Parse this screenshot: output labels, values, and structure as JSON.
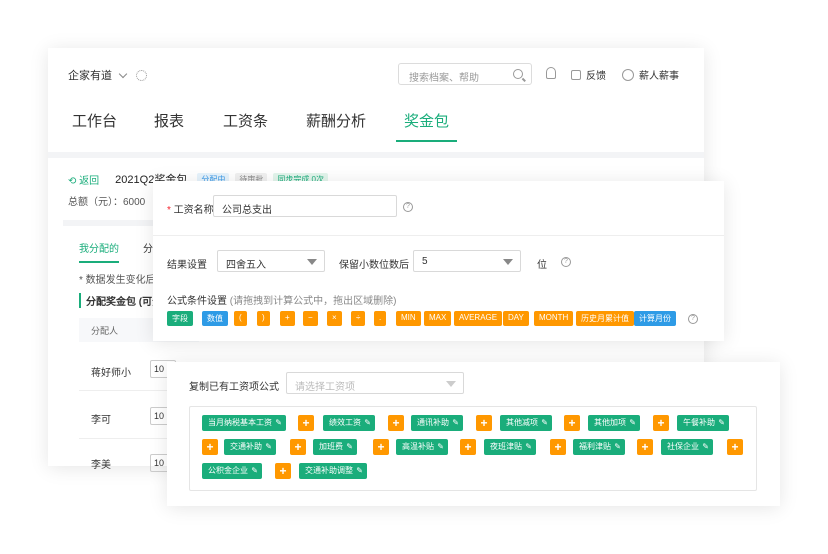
{
  "header": {
    "company": "企家有道",
    "search_placeholder": "搜索档案、帮助",
    "feedback": "反馈",
    "user": "薪人薪事"
  },
  "tabs": [
    "工作台",
    "报表",
    "工资条",
    "薪酬分析",
    "奖金包"
  ],
  "bonus": {
    "back": "返回",
    "title": "2021Q2奖金包",
    "badges": [
      "分配中",
      "待审批",
      "同步完成 0次"
    ],
    "total": "总额（元）：6000",
    "subtabs": [
      "我分配的",
      "分"
    ],
    "note": "* 数据发生变化后",
    "alloc_title": "分配奖金包 (可分",
    "col_allocator": "分配人",
    "rows": [
      {
        "name": "蒋好师小",
        "value": "10"
      },
      {
        "name": "李可",
        "value": "10"
      },
      {
        "name": "李美",
        "value": "10"
      }
    ]
  },
  "form": {
    "name_label": "工资名称",
    "name_value": "公司总支出",
    "result_label": "结果设置",
    "result_value": "四舍五入",
    "decimals_label": "保留小数位数后",
    "decimals_value": "5",
    "decimals_unit": "位",
    "formula_label": "公式条件设置",
    "formula_hint": "(请拖拽到计算公式中，拖出区域删除)",
    "tokens": [
      "字段",
      "数值",
      "(",
      ")",
      "+",
      "−",
      "×",
      "÷",
      ".",
      "MIN",
      "MAX",
      "AVERAGE",
      "DAY",
      "MONTH",
      "历史月累计值",
      "计算月份"
    ]
  },
  "copy": {
    "label": "复制已有工资项公式",
    "placeholder": "请选择工资项",
    "chips": [
      "当月纳税基本工资",
      "绩效工资",
      "通讯补助",
      "其他减项",
      "其他加项",
      "午餐补助",
      "交通补助",
      "加班费",
      "高温补贴",
      "夜班津贴",
      "福利津贴",
      "社保企业",
      "公积金企业",
      "交通补助调整"
    ],
    "plus": "+"
  },
  "colors": {
    "primary": "#1aad7b",
    "blue": "#2e9be6",
    "orange": "#ff9800"
  }
}
